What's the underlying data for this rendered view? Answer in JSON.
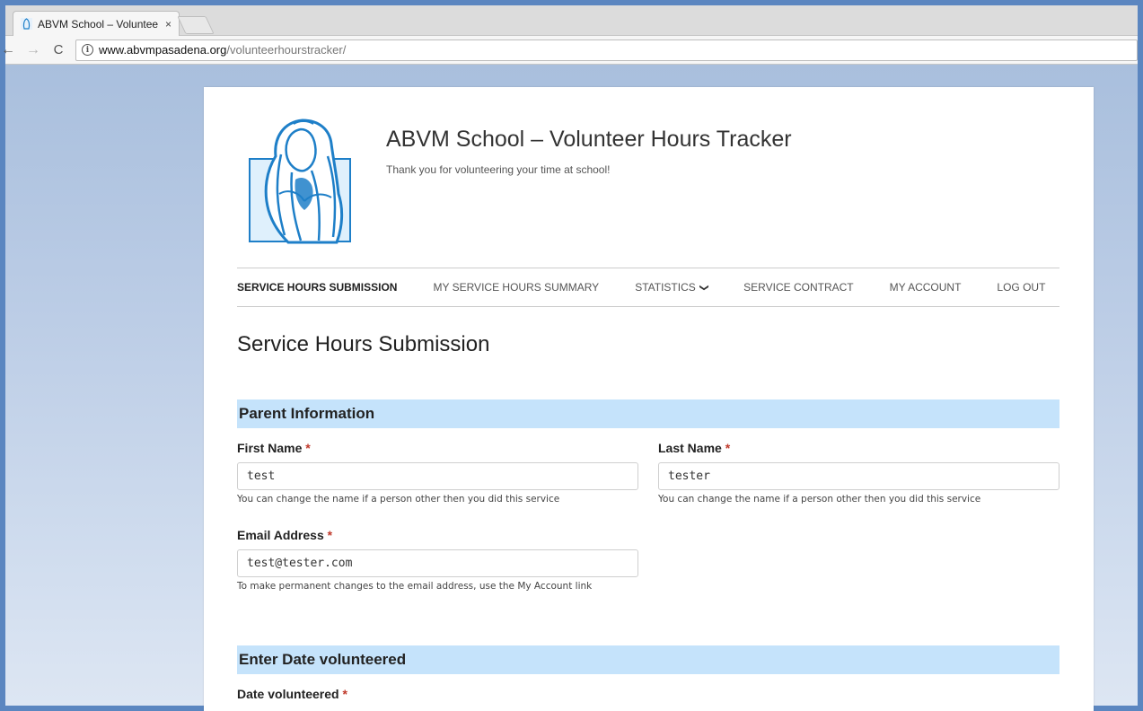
{
  "browser": {
    "tab_title": "ABVM School – Voluntee",
    "tab_close": "×",
    "url_domain": "www.abvmpasadena.org",
    "url_path": "/volunteerhourstracker/",
    "back_glyph": "←",
    "forward_glyph": "→",
    "reload_glyph": "C",
    "info_glyph": "i"
  },
  "site": {
    "title": "ABVM School – Volunteer Hours Tracker",
    "tagline": "Thank you for volunteering your time at school!",
    "logo_icon": "madonna-logo-icon",
    "accent_color": "#1e7fc8"
  },
  "nav": {
    "items": [
      {
        "label": "SERVICE HOURS SUBMISSION",
        "active": true
      },
      {
        "label": "MY SERVICE HOURS SUMMARY"
      },
      {
        "label": "STATISTICS",
        "has_dropdown": true
      },
      {
        "label": "SERVICE CONTRACT"
      },
      {
        "label": "MY ACCOUNT"
      },
      {
        "label": "LOG OUT"
      }
    ],
    "dropdown_glyph": "❯"
  },
  "main": {
    "page_title": "Service Hours Submission",
    "sections": [
      {
        "title": "Parent Information"
      },
      {
        "title": "Enter Date volunteered"
      }
    ],
    "required_marker": "*",
    "first_name": {
      "label": "First Name",
      "value": "test",
      "help": "You can change the name if a person other then you did this service"
    },
    "last_name": {
      "label": "Last Name",
      "value": "tester",
      "help": "You can change the name if a person other then you did this service"
    },
    "email": {
      "label": "Email Address",
      "value": "test@tester.com",
      "help": "To make permanent changes to the email address, use the My Account link"
    },
    "date_volunteered": {
      "label": "Date volunteered"
    }
  }
}
